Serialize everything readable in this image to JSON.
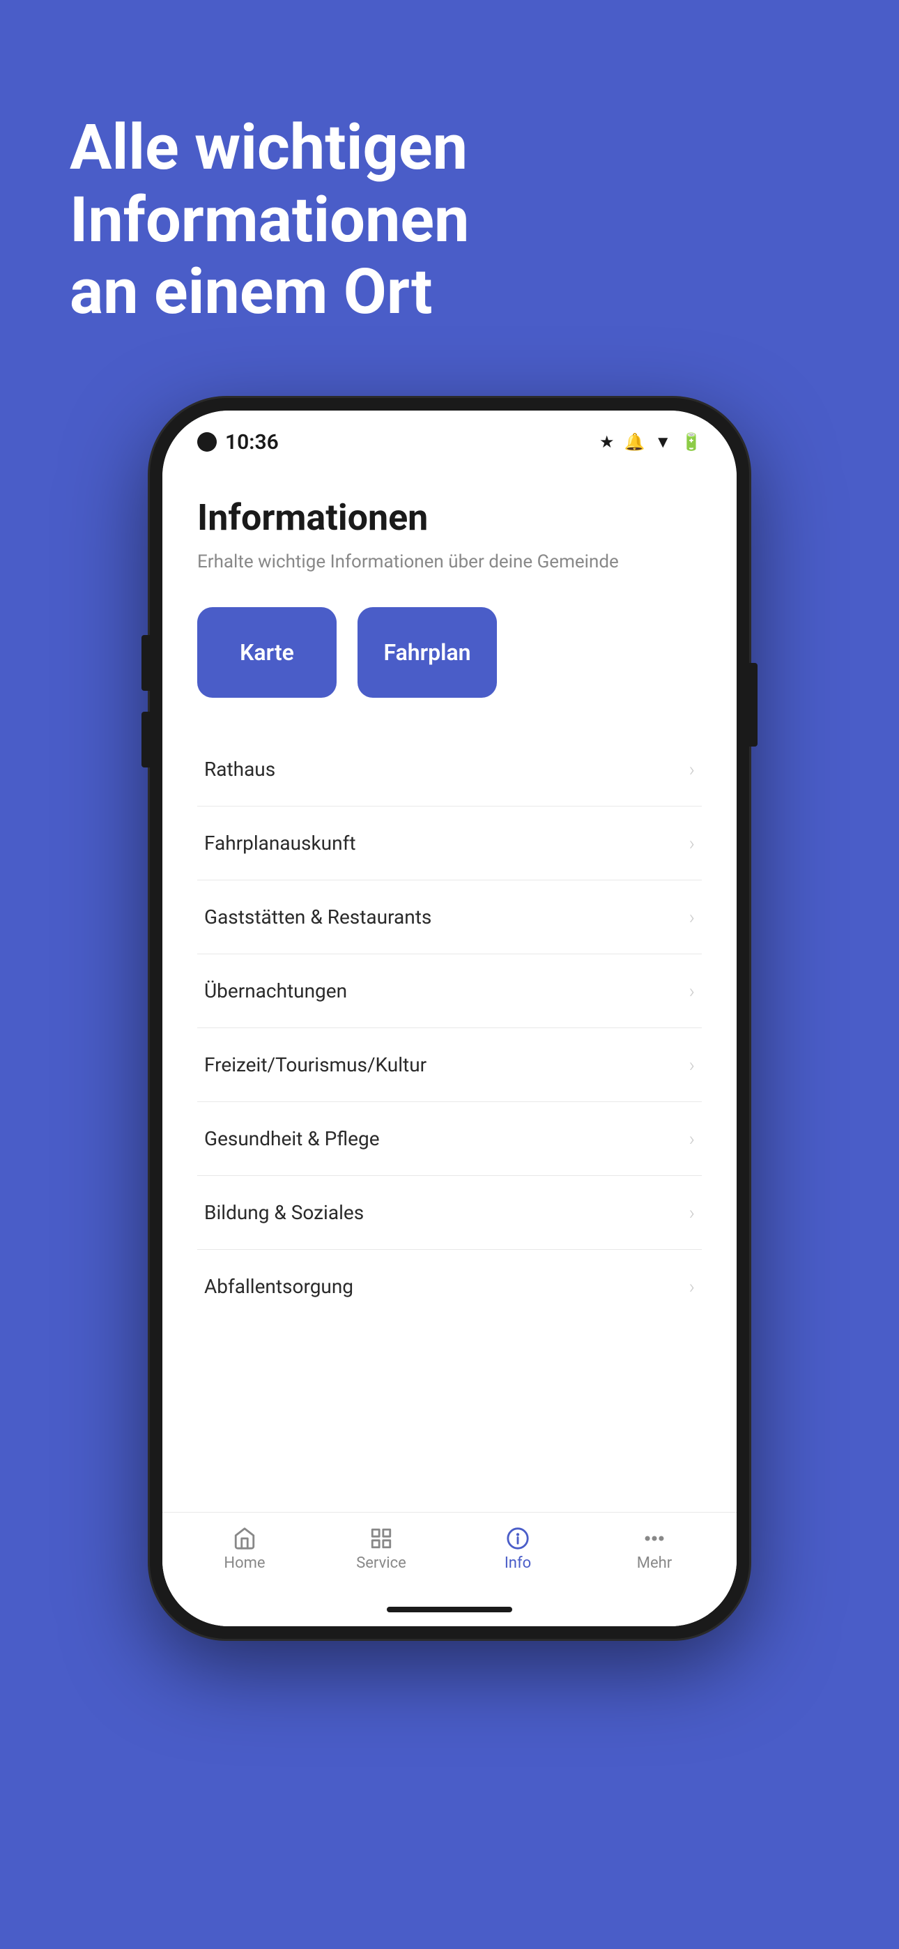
{
  "background_color": "#4a5dc8",
  "hero": {
    "title_line1": "Alle wichtigen Informationen",
    "title_line2": "an einem Ort"
  },
  "phone": {
    "status_bar": {
      "time": "10:36",
      "icons": [
        "bluetooth",
        "bell-off",
        "wifi",
        "battery"
      ]
    },
    "app": {
      "title": "Informationen",
      "subtitle": "Erhalte wichtige Informationen über deine Gemeinde",
      "quick_buttons": [
        {
          "label": "Karte"
        },
        {
          "label": "Fahrplan"
        }
      ],
      "menu_items": [
        {
          "label": "Rathaus"
        },
        {
          "label": "Fahrplanauskunft"
        },
        {
          "label": "Gaststätten & Restaurants"
        },
        {
          "label": "Übernachtungen"
        },
        {
          "label": "Freizeit/Tourismus/Kultur"
        },
        {
          "label": "Gesundheit & Pflege"
        },
        {
          "label": "Bildung & Soziales"
        },
        {
          "label": "Abfallentsorgung"
        }
      ]
    },
    "bottom_nav": [
      {
        "id": "home",
        "label": "Home",
        "icon": "🏠",
        "active": false
      },
      {
        "id": "service",
        "label": "Service",
        "icon": "⊞",
        "active": false
      },
      {
        "id": "info",
        "label": "Info",
        "icon": "ℹ",
        "active": true
      },
      {
        "id": "mehr",
        "label": "Mehr",
        "icon": "•••",
        "active": false
      }
    ]
  }
}
